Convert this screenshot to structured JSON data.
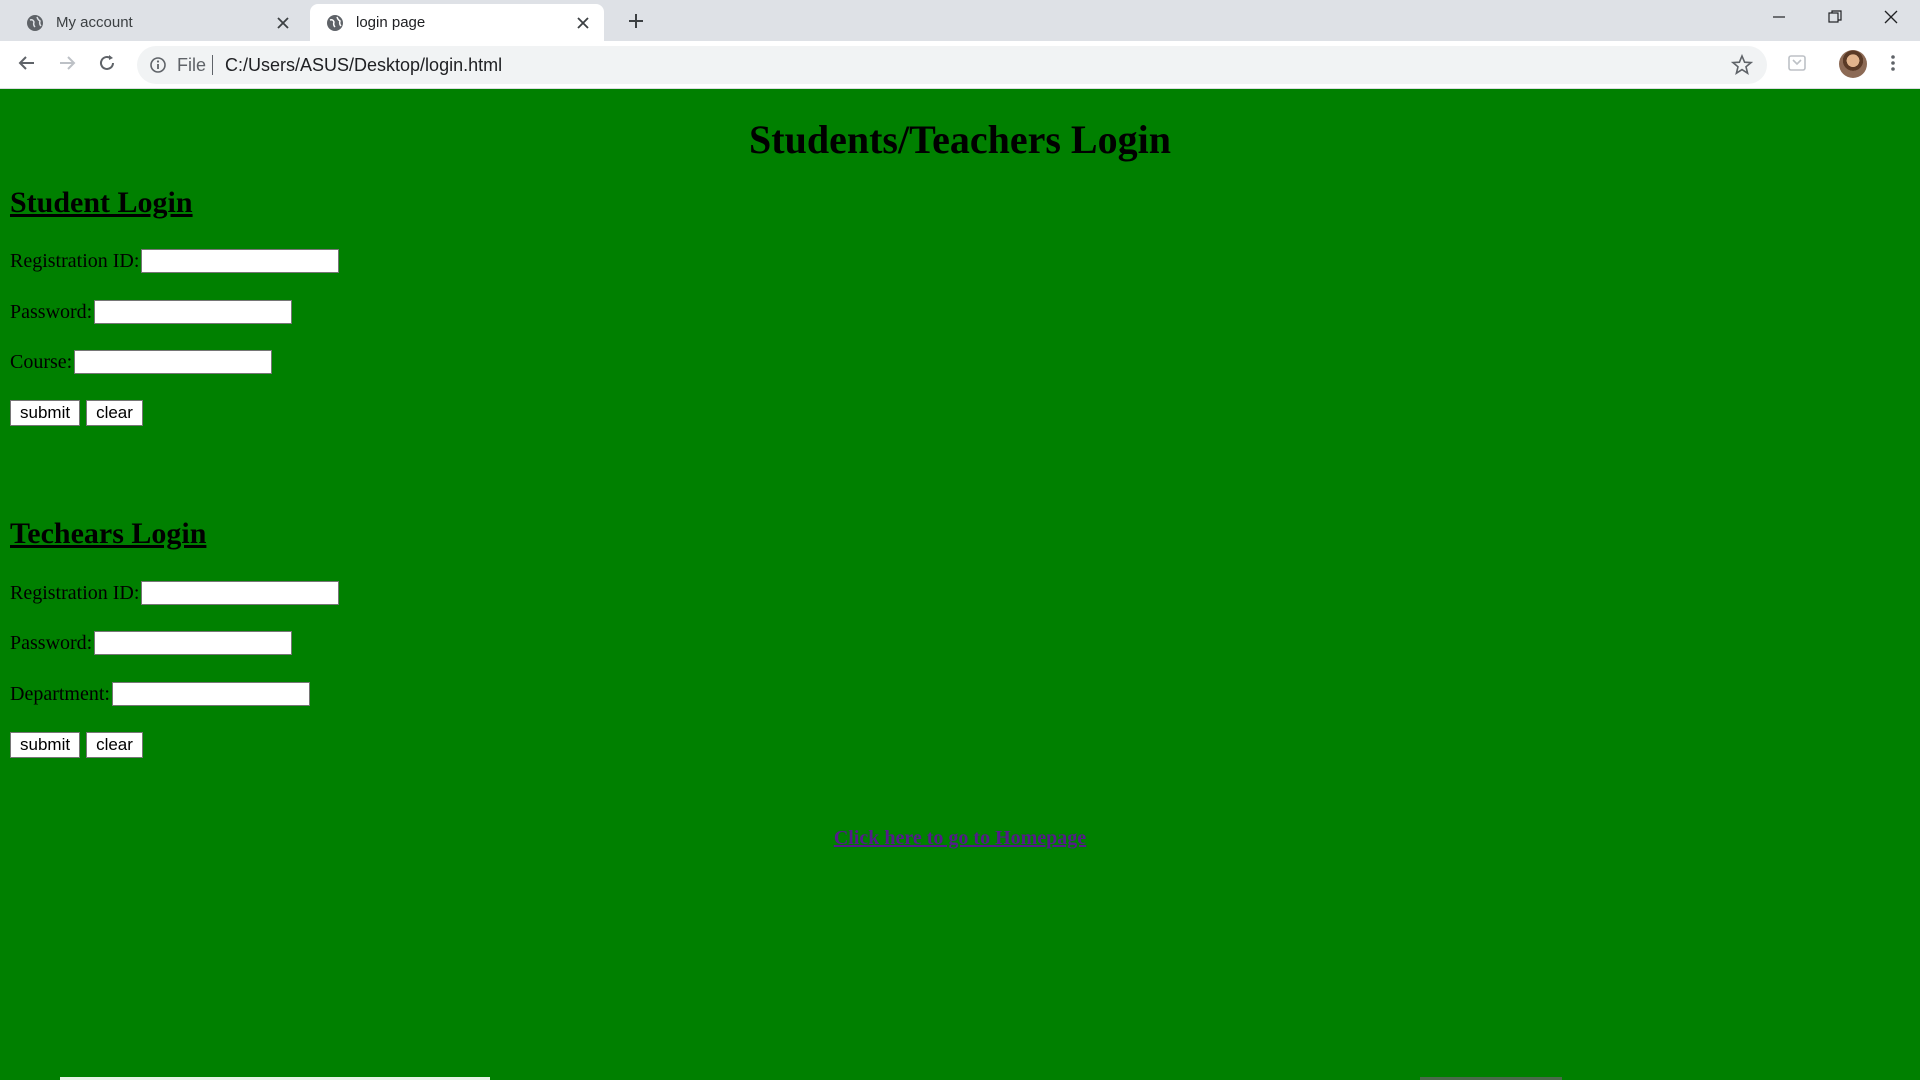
{
  "browser": {
    "tabs": [
      {
        "title": "My account",
        "active": false
      },
      {
        "title": "login page",
        "active": true
      }
    ],
    "address": {
      "scheme_label": "File",
      "url": "C:/Users/ASUS/Desktop/login.html"
    }
  },
  "page": {
    "background_color": "#008000",
    "title": "Students/Teachers Login",
    "student": {
      "heading": "Student Login",
      "fields": [
        {
          "label": "Registration ID:",
          "value": ""
        },
        {
          "label": "Password:",
          "value": ""
        },
        {
          "label": "Course:",
          "value": ""
        }
      ],
      "submit_label": "submit",
      "clear_label": "clear"
    },
    "teacher": {
      "heading": "Techears Login",
      "fields": [
        {
          "label": "Registration ID:",
          "value": ""
        },
        {
          "label": "Password:",
          "value": ""
        },
        {
          "label": "Department:",
          "value": ""
        }
      ],
      "submit_label": "submit",
      "clear_label": "clear"
    },
    "home_link": "Click here to go to Homepage"
  },
  "icons": [
    "globe-icon",
    "close-icon",
    "plus-icon",
    "minimize-icon",
    "restore-icon",
    "back-icon",
    "forward-icon",
    "reload-icon",
    "info-icon",
    "star-icon",
    "extension-icon",
    "menu-icon"
  ]
}
